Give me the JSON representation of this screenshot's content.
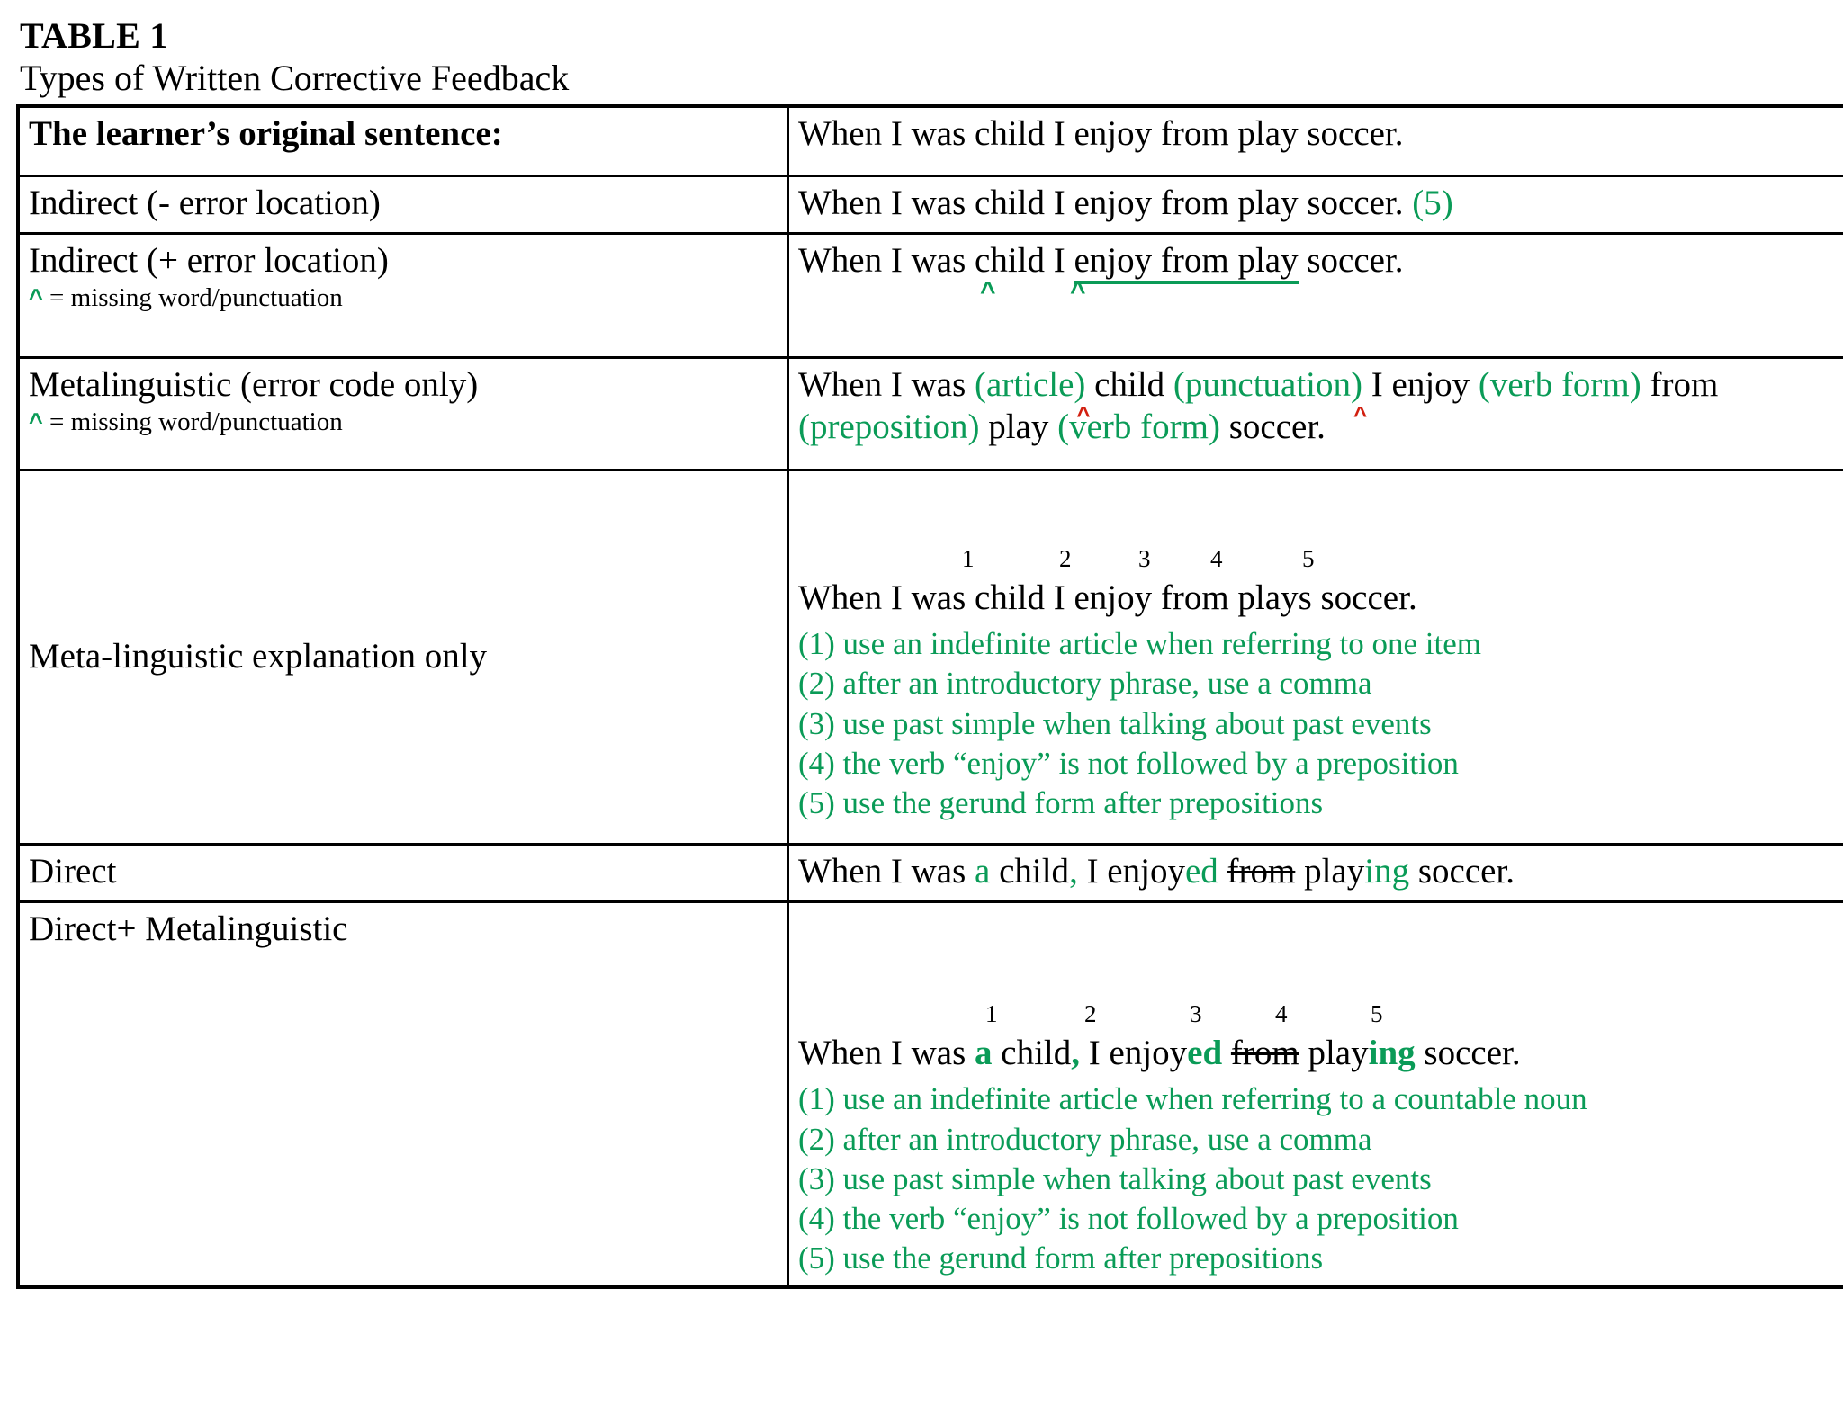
{
  "heading": {
    "table_number": "TABLE 1",
    "caption": "Types of Written Corrective Feedback"
  },
  "legend": {
    "caret_symbol": "^",
    "caret_note": " = missing word/punctuation"
  },
  "colors": {
    "green": "#0a9b57",
    "red_caret": "#d21f0f",
    "border": "#000000"
  },
  "rows": {
    "original": {
      "label": "The learner’s original sentence:",
      "sentence": "When I was child I enjoy from play soccer."
    },
    "indirect_no_loc": {
      "label": "Indirect (- error location)",
      "sentence": "When I was child I enjoy from play soccer.",
      "code": "(5)"
    },
    "indirect_loc": {
      "label": "Indirect (+ error location)",
      "sentence_before": "When I was child I ",
      "sentence_underlined": "enjoy from play",
      "sentence_after": " soccer.",
      "carets": [
        "^",
        "^"
      ]
    },
    "metalinguistic_code": {
      "label": "Metalinguistic (error code only)",
      "parts": [
        {
          "text": "When I was ",
          "style": "plain"
        },
        {
          "text": "(article)",
          "style": "green",
          "caret": "^"
        },
        {
          "text": " child ",
          "style": "plain"
        },
        {
          "text": "(punctuation)",
          "style": "green",
          "caret": "^"
        },
        {
          "text": " I enjoy ",
          "style": "plain"
        },
        {
          "text": "(verb form)",
          "style": "green"
        },
        {
          "text": " from ",
          "style": "plain"
        },
        {
          "text": "(preposition)",
          "style": "green"
        },
        {
          "text": " play ",
          "style": "plain"
        },
        {
          "text": "(verb form)",
          "style": "green"
        },
        {
          "text": " soccer.",
          "style": "plain"
        }
      ]
    },
    "metalinguistic_explanation": {
      "label": "Meta-linguistic explanation only",
      "markers": [
        "1",
        "2",
        "3",
        "4",
        "5"
      ],
      "sentence": "When I was child I enjoy from plays soccer.",
      "rules": [
        "(1) use an indefinite article when referring to one item",
        "(2) after an introductory phrase, use a comma",
        "(3) use past simple when talking about past events",
        "(4) the verb “enjoy” is not followed by a preposition",
        "(5) use the gerund form after prepositions"
      ]
    },
    "direct": {
      "label": "Direct",
      "parts": [
        {
          "text": "When I was ",
          "style": "plain"
        },
        {
          "text": "a",
          "style": "green"
        },
        {
          "text": " child",
          "style": "plain"
        },
        {
          "text": ",",
          "style": "green"
        },
        {
          "text": " I enjoy",
          "style": "plain"
        },
        {
          "text": "ed",
          "style": "green"
        },
        {
          "text": " ",
          "style": "plain"
        },
        {
          "text": "from",
          "style": "strike"
        },
        {
          "text": " play",
          "style": "plain"
        },
        {
          "text": "ing",
          "style": "green"
        },
        {
          "text": " soccer.",
          "style": "plain"
        }
      ]
    },
    "direct_metalinguistic": {
      "label": "Direct+ Metalinguistic",
      "markers": [
        "1",
        "2",
        "3",
        "4",
        "5"
      ],
      "parts": [
        {
          "text": "When I was ",
          "style": "plain"
        },
        {
          "text": "a",
          "style": "green-bold"
        },
        {
          "text": " child",
          "style": "plain"
        },
        {
          "text": ",",
          "style": "green-bold"
        },
        {
          "text": " I enjoy",
          "style": "plain"
        },
        {
          "text": "ed",
          "style": "green-bold"
        },
        {
          "text": " ",
          "style": "plain"
        },
        {
          "text": "from",
          "style": "strike"
        },
        {
          "text": " play",
          "style": "plain"
        },
        {
          "text": "ing",
          "style": "green-bold"
        },
        {
          "text": " soccer.",
          "style": "plain"
        }
      ],
      "rules": [
        "(1) use an indefinite article when referring to a countable noun",
        "(2) after an introductory phrase, use a comma",
        "(3) use past simple when talking about past events",
        "(4) the verb “enjoy” is not followed by a preposition",
        "(5) use the gerund form after prepositions"
      ]
    }
  }
}
